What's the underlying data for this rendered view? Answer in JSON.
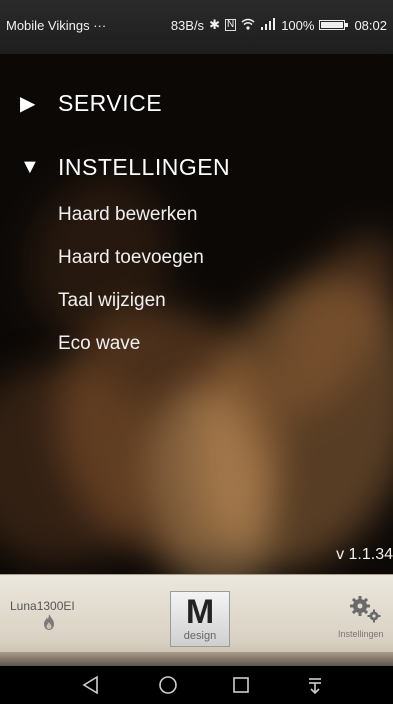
{
  "status_bar": {
    "carrier": "Mobile Vikings ···",
    "speed": "83B/s",
    "icons": [
      "bluetooth-icon",
      "nfc-icon",
      "wifi-icon",
      "signal-icon"
    ],
    "battery": "100%",
    "time": "08:02"
  },
  "menu": {
    "service_label": "SERVICE",
    "settings_label": "INSTELLINGEN",
    "settings_items": [
      {
        "label": "Haard bewerken"
      },
      {
        "label": "Haard toevoegen"
      },
      {
        "label": "Taal wijzigen"
      },
      {
        "label": "Eco wave"
      }
    ]
  },
  "version": "v 1.1.34",
  "toolbar": {
    "device_name": "Luna1300EI",
    "logo_letter": "M",
    "logo_sub": "design",
    "settings_label": "Instellingen"
  },
  "nav": {
    "icons": [
      "back-icon",
      "home-icon",
      "recents-icon",
      "notifications-icon"
    ]
  }
}
